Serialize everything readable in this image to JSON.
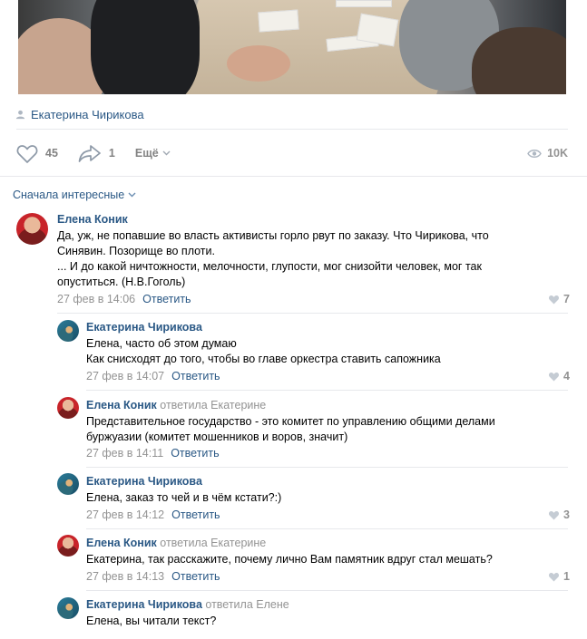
{
  "post": {
    "author": "Екатерина Чирикова",
    "likes": "45",
    "shares": "1",
    "more_label": "Ещё",
    "views": "10K"
  },
  "sort_label": "Сначала интересные",
  "comments": [
    {
      "author": "Елена Коник",
      "reply_to": "",
      "text_lines": [
        "Да, уж, не попавшие во власть активисты горло рвут по заказу. Что Чирикова, что",
        "Синявин. Позорище во плоти.",
        "... И до какой ничтожности, мелочности, глупости, мог снизойти человек, мог так",
        "опуститься. (Н.В.Гоголь)"
      ],
      "date": "27 фев в 14:06",
      "reply_label": "Ответить",
      "likes": "7"
    },
    {
      "author": "Екатерина Чирикова",
      "reply_to": "",
      "text_lines": [
        "Елена, часто об этом думаю",
        "Как снисходят до того, чтобы во главе оркестра ставить сапожника"
      ],
      "date": "27 фев в 14:07",
      "reply_label": "Ответить",
      "likes": "4"
    },
    {
      "author": "Елена Коник",
      "reply_to": "ответила Екатерине",
      "text_lines": [
        "Представительное государство - это комитет по управлению общими делами",
        "буржуазии (комитет мошенников и воров, значит)"
      ],
      "date": "27 фев в 14:11",
      "reply_label": "Ответить",
      "likes": ""
    },
    {
      "author": "Екатерина Чирикова",
      "reply_to": "",
      "text_lines": [
        "Елена, заказ то чей и в чём кстати?:)"
      ],
      "date": "27 фев в 14:12",
      "reply_label": "Ответить",
      "likes": "3"
    },
    {
      "author": "Елена Коник",
      "reply_to": "ответила Екатерине",
      "text_lines": [
        "Екатерина, так расскажите, почему лично Вам памятник вдруг стал мешать?"
      ],
      "date": "27 фев в 14:13",
      "reply_label": "Ответить",
      "likes": "1"
    },
    {
      "author": "Екатерина Чирикова",
      "reply_to": "ответила Елене",
      "text_lines": [
        "Елена, вы читали текст?"
      ],
      "date": "",
      "reply_label": "",
      "likes": ""
    }
  ],
  "icons": {
    "author": "person-icon",
    "like": "heart-icon",
    "share": "share-arrow-icon",
    "more": "chevron-down-icon",
    "views": "eye-icon",
    "comment_like": "heart-icon"
  },
  "colors": {
    "link": "#2a5885",
    "muted": "#939393",
    "separator": "#e7e8ec"
  }
}
